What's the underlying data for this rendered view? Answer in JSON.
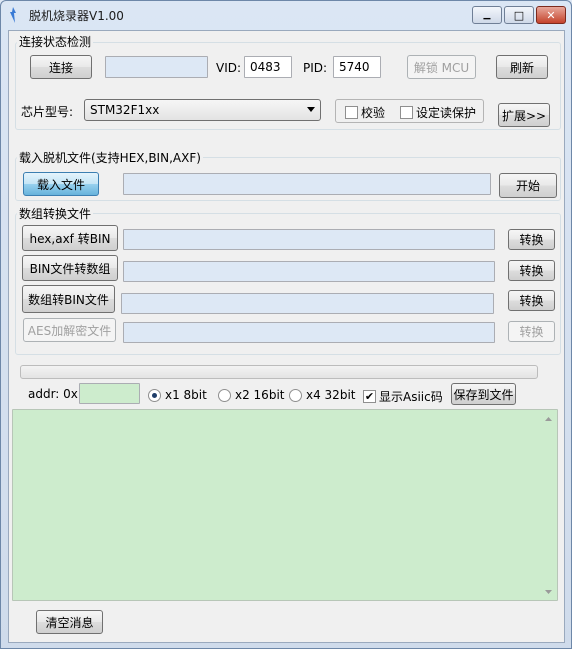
{
  "window": {
    "title": "脱机烧录器V1.00",
    "minimize_glyph": "▁",
    "maximize_glyph": "□",
    "close_glyph": "✕"
  },
  "connection": {
    "group_label": "连接状态检测",
    "connect_label": "连接",
    "status_value": "",
    "vid_label": "VID:",
    "vid_value": "0483",
    "pid_label": "PID:",
    "pid_value": "5740",
    "unlock_label": "解锁 MCU",
    "refresh_label": "刷新",
    "chip_label": "芯片型号:",
    "chip_value": "STM32F1xx",
    "verify_label": "校验",
    "verify_checked": false,
    "readprotect_label": "设定读保护",
    "readprotect_checked": false,
    "expand_label": "扩展>>"
  },
  "load": {
    "group_label": "载入脱机文件(支持HEX,BIN,AXF)",
    "load_label": "载入文件",
    "file_path": "",
    "start_label": "开始"
  },
  "convert": {
    "group_label": "数组转换文件",
    "rows": [
      {
        "label": "hex,axf 转BIN",
        "value": "",
        "action": "转换",
        "enabled": true
      },
      {
        "label": "BIN文件转数组",
        "value": "",
        "action": "转换",
        "enabled": true
      },
      {
        "label": "数组转BIN文件",
        "value": "",
        "action": "转换",
        "enabled": true
      },
      {
        "label": "AES加解密文件",
        "value": "",
        "action": "转换",
        "enabled": false
      }
    ]
  },
  "progress": {
    "value": 0
  },
  "viewer": {
    "addr_label": "addr: 0x",
    "addr_value": "",
    "radio_x1": "x1 8bit",
    "radio_x2": "x2 16bit",
    "radio_x4": "x4 32bit",
    "selected": "x1 8bit",
    "ascii_label": "显示Asiic码",
    "ascii_checked": true,
    "save_label": "保存到文件",
    "output_text": ""
  },
  "footer": {
    "clear_label": "清空消息"
  },
  "colors": {
    "field_bg": "#dde8f5",
    "output_bg": "#cdeccd",
    "accent_blue": "#68b3db"
  }
}
